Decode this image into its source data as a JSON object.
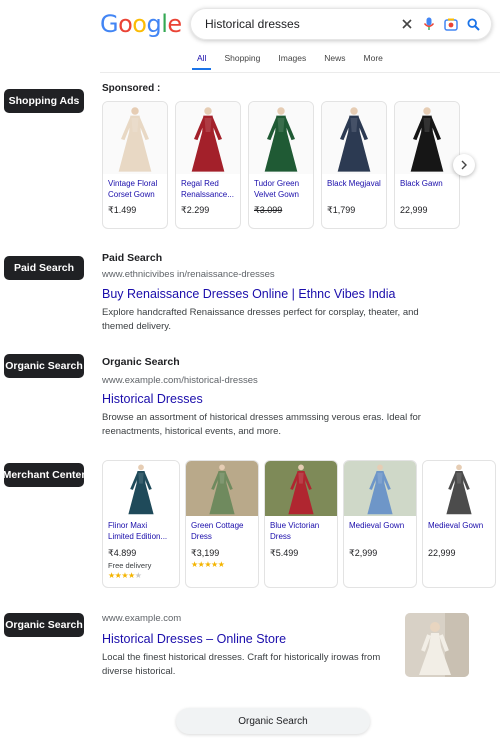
{
  "header": {
    "logo_letters": [
      "G",
      "o",
      "o",
      "g",
      "l",
      "e"
    ],
    "logo_colors": [
      "#4285F4",
      "#EA4335",
      "#FBBC05",
      "#4285F4",
      "#34A853",
      "#EA4335"
    ],
    "search_query": "Historical dresses",
    "tabs": [
      "All",
      "Shopping",
      "Images",
      "News",
      "More"
    ]
  },
  "labels": {
    "shopping_ads": "Shopping Ads",
    "paid_search": "Paid Search",
    "organic_search": "Organic Search",
    "merchant_center": "Merchant Center",
    "organic_search_2": "Organic Search"
  },
  "sponsored": {
    "heading": "Sponsored :",
    "products": [
      {
        "name": "Vintage Floral Corset Gown",
        "price": "₹1.499",
        "color": "#e8d8c4"
      },
      {
        "name": "Regal Red Renalssance...",
        "price": "₹2.299",
        "color": "#a3202a"
      },
      {
        "name": "Tudor Green Velvet Gown",
        "price": "₹3.099",
        "color": "#1f5a34"
      },
      {
        "name": "Black Megjaval",
        "price": "₹1,799",
        "color": "#2c3a52"
      },
      {
        "name": "Black Gawn",
        "price": "22,999",
        "color": "#161616"
      }
    ]
  },
  "paid": {
    "heading": "Paid Search",
    "url": "www.ethnicivibes in/renaissance-dresses",
    "title": "Buy Renaissance Dresses Online | Ethnc Vibes India",
    "desc": "Explore handcrafted Renaissance dresses perfect for corsplay, theater, and themed delivery."
  },
  "organic1": {
    "heading": "Organic Search",
    "url": "www.example.com/historical-dresses",
    "title": "Historical Dresses",
    "desc": "Browse an assortment of historical dresses ammssing verous eras. Ideal for reenactments, historical events, and more."
  },
  "merchant": {
    "products": [
      {
        "name": "Flinor Maxi Limited Edition...",
        "price": "₹4.899",
        "delivery": "Free delivery",
        "rating": 4,
        "color": "#1f4a5a",
        "bg": "#ffffff"
      },
      {
        "name": "Green Cottage Dress",
        "price": "₹3,199",
        "delivery": "",
        "rating": 5,
        "color": "#6f8a5e",
        "bg": "#b9a98a"
      },
      {
        "name": "Blue Victorian Dress",
        "price": "₹5.499",
        "delivery": "",
        "rating": 0,
        "color": "#b02630",
        "bg": "#7e8a58"
      },
      {
        "name": "Medieval Gown",
        "price": "₹2,999",
        "delivery": "",
        "rating": 0,
        "color": "#6e96c8",
        "bg": "#cfd8c8"
      },
      {
        "name": "Medieval Gown",
        "price": "22,999",
        "delivery": "",
        "rating": 0,
        "color": "#4c4c4c",
        "bg": "#ffffff"
      }
    ]
  },
  "organic2": {
    "url": "www.example.com",
    "title": "Historical Dresses – Online Store",
    "desc": "Local the finest historical dresses. Craft for historically irowas from diverse historical."
  },
  "bottom_button": "Organic Search",
  "colors": {
    "link": "#1a0dab",
    "label_bg": "#202124",
    "star": "#f4b400"
  }
}
